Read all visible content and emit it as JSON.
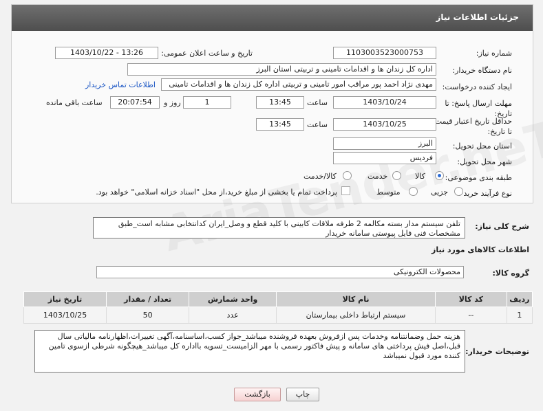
{
  "header": {
    "title": "جزئیات اطلاعات نیاز"
  },
  "fields": {
    "need_number_label": "شماره نیاز:",
    "need_number": "1103003523000753",
    "announce_label": "تاریخ و ساعت اعلان عمومی:",
    "announce_value": "1403/10/22 - 13:26",
    "buyer_org_label": "نام دستگاه خریدار:",
    "buyer_org": "اداره کل زندان ها و اقدامات تامینی و تربیتی استان البرز",
    "creator_label": "ایجاد کننده درخواست:",
    "creator": "مهدی نژاد احمد پور مراقب امور تامینی و تربیتی اداره کل زندان ها و اقدامات تامینی",
    "buyer_contact_link": "اطلاعات تماس خریدار",
    "deadline_label": "مهلت ارسال پاسخ: تا تاریخ:",
    "deadline_date": "1403/10/24",
    "time_label": "ساعت",
    "deadline_time": "13:45",
    "days_value": "1",
    "days_label": "روز و",
    "remaining_time": "20:07:54",
    "remaining_label": "ساعت باقی مانده",
    "price_validity_label": "حداقل تاریخ اعتبار قیمت: تا تاریخ:",
    "price_validity_date": "1403/10/25",
    "price_validity_time": "13:45",
    "province_label": "استان محل تحویل:",
    "province": "البرز",
    "city_label": "شهر محل تحویل:",
    "city": "فردیس",
    "category_label": "طبقه بندی موضوعی:",
    "category_options": [
      "کالا",
      "خدمت",
      "کالا/خدمت"
    ],
    "purchase_type_label": "نوع فرآیند خرید :",
    "purchase_type_options": [
      "جزیی",
      "متوسط"
    ],
    "payment_note": "پرداخت تمام یا بخشی از مبلغ خرید،از محل \"اسناد خزانه اسلامی\" خواهد بود."
  },
  "summary": {
    "label": "شرح کلی نیاز:",
    "text": "تلفن سیستم مدار بسته مکالمه 2 طرفه ملاقات کابینی با کلید قطع و وصل_ایران کدانتخابی مشابه است_طبق مشخصات فنی فایل پیوستی سامانه خریدار"
  },
  "goods": {
    "section_title": "اطلاعات کالاهای مورد نیاز",
    "group_label": "گروه کالا:",
    "group_value": "محصولات الکترونیکی",
    "columns": [
      "ردیف",
      "کد کالا",
      "نام کالا",
      "واحد شمارش",
      "تعداد / مقدار",
      "تاریخ نیاز"
    ],
    "rows": [
      [
        "1",
        "--",
        "سیستم ارتباط داخلی بیمارستان",
        "عدد",
        "50",
        "1403/10/25"
      ]
    ]
  },
  "buyer_notes": {
    "label": "توضیحات خریدار:",
    "text": "هزینه حمل وضمانتنامه وخدمات پس ازفروش بعهده فروشنده میباشد_جواز کسب،اساسنامه،آگهی تغییرات،اظهارنامه مالیاتی سال قبل،اصل فیش پرداختی های سامانه و پیش فاکتور رسمی با مهر الزامیست_تسویه بااداره کل میباشد_هیچگونه شرطی ازسوی تامین کننده مورد قبول نمیباشد"
  },
  "buttons": {
    "print": "چاپ",
    "back": "بازگشت"
  },
  "watermark": "AriaTender.neT"
}
